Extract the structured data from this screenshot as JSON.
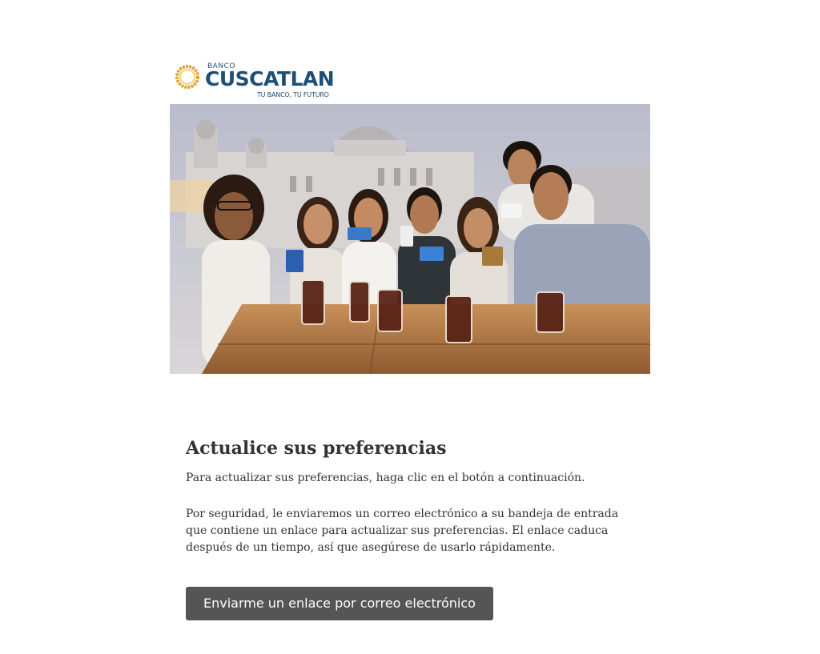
{
  "logo": {
    "banco": "BANCO",
    "name": "CUSCATLAN",
    "tagline": "TU BANCO, TU FUTURO",
    "ring_color": "#e0a328",
    "text_color": "#1d4e74"
  },
  "hero": {
    "description_icon": "group-photo"
  },
  "content": {
    "title": "Actualice sus preferencias",
    "paragraph1": "Para actualizar sus preferencias, haga clic en el botón a continuación.",
    "paragraph2": "Por seguridad, le enviaremos un correo electrónico a su bandeja de entrada que contiene un enlace para actualizar sus preferencias. El enlace caduca después de un tiempo, así que asegúrese de usarlo rápidamente."
  },
  "button": {
    "label": "Enviarme un enlace por correo electrónico",
    "color": "#555555"
  }
}
